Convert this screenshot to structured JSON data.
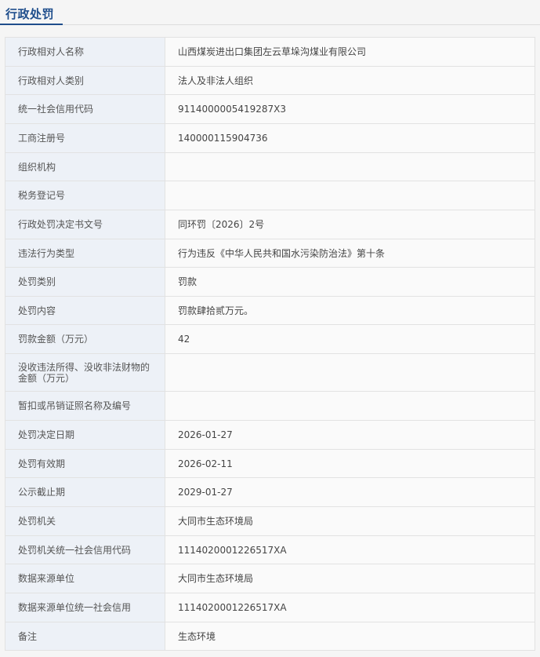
{
  "section": {
    "title": "行政处罚"
  },
  "rows": [
    {
      "label": "行政相对人名称",
      "value": "山西煤炭进出口集团左云草垛沟煤业有限公司"
    },
    {
      "label": "行政相对人类别",
      "value": "法人及非法人组织"
    },
    {
      "label": "统一社会信用代码",
      "value": "9114000005419287X3"
    },
    {
      "label": "工商注册号",
      "value": "140000115904736"
    },
    {
      "label": "组织机构",
      "value": ""
    },
    {
      "label": "税务登记号",
      "value": ""
    },
    {
      "label": "行政处罚决定书文号",
      "value": "同环罚〔2026〕2号"
    },
    {
      "label": "违法行为类型",
      "value": "行为违反《中华人民共和国水污染防治法》第十条"
    },
    {
      "label": "处罚类别",
      "value": "罚款"
    },
    {
      "label": "处罚内容",
      "value": "罚款肆拾贰万元。"
    },
    {
      "label": "罚款金额（万元）",
      "value": "42"
    },
    {
      "label": "没收违法所得、没收非法财物的金额（万元）",
      "value": ""
    },
    {
      "label": "暂扣或吊销证照名称及编号",
      "value": ""
    },
    {
      "label": "处罚决定日期",
      "value": "2026-01-27"
    },
    {
      "label": "处罚有效期",
      "value": "2026-02-11"
    },
    {
      "label": "公示截止期",
      "value": "2029-01-27"
    },
    {
      "label": "处罚机关",
      "value": "大同市生态环境局"
    },
    {
      "label": "处罚机关统一社会信用代码",
      "value": "1114020001226517XA"
    },
    {
      "label": "数据来源单位",
      "value": "大同市生态环境局"
    },
    {
      "label": "数据来源单位统一社会信用",
      "value": "1114020001226517XA"
    },
    {
      "label": "备注",
      "value": "生态环境"
    }
  ]
}
